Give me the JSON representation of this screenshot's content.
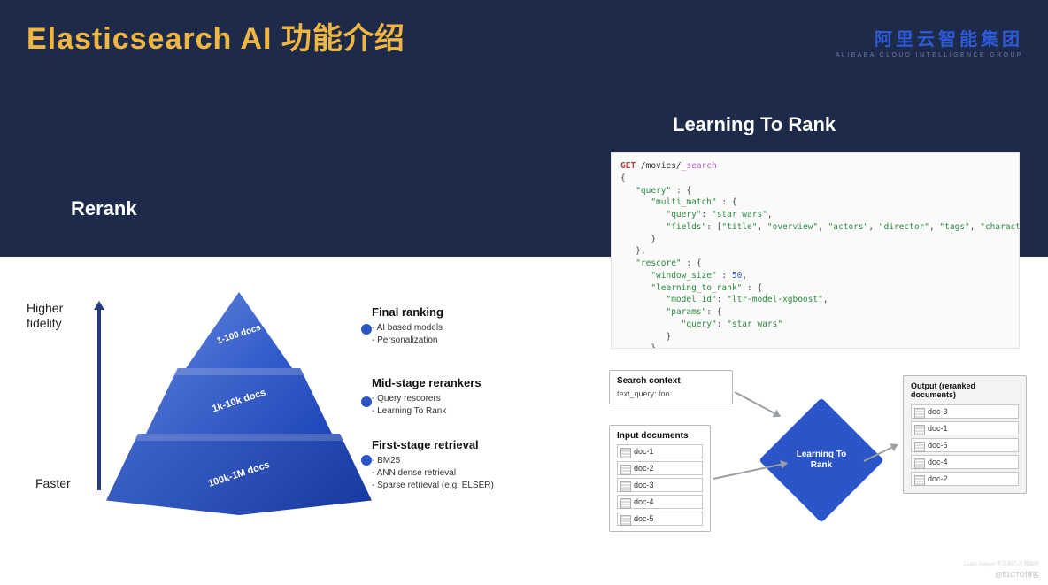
{
  "title": "Elasticsearch AI  功能介绍",
  "brand": {
    "cn": "阿里云智能集团",
    "en": "ALIBABA CLOUD INTELLIGENCE GROUP"
  },
  "left_heading": "Rerank",
  "right_heading": "Learning To Rank",
  "axis": {
    "top1": "Higher",
    "top2": "fidelity",
    "bottom": "Faster"
  },
  "pyramid": {
    "tier1": "1-100 docs",
    "tier2": "1k-10k docs",
    "tier3": "100k-1M docs"
  },
  "stages": [
    {
      "title": "Final ranking",
      "items": [
        "AI based models",
        "Personalization"
      ]
    },
    {
      "title": "Mid-stage rerankers",
      "items": [
        "Query rescorers",
        "Learning To Rank"
      ]
    },
    {
      "title": "First-stage retrieval",
      "items": [
        "BM25",
        "ANN dense retrieval",
        "Sparse retrieval (e.g. ELSER)"
      ]
    }
  ],
  "code": {
    "method": "GET",
    "path_pre": " /movies/",
    "path_us": "_search",
    "body": {
      "query": {
        "multi_match": {
          "query": "star wars",
          "fields": [
            "title",
            "overview",
            "actors",
            "director",
            "tags",
            "characters"
          ]
        }
      },
      "rescore": {
        "window_size": 50,
        "learning_to_rank": {
          "model_id": "ltr-model-xgboost",
          "params": {
            "query": "star wars"
          }
        }
      }
    }
  },
  "flow": {
    "search_ctx_title": "Search context",
    "search_ctx_value": "text_query: foo",
    "input_title": "Input documents",
    "input_docs": [
      "doc-1",
      "doc-2",
      "doc-3",
      "doc-4",
      "doc-5"
    ],
    "node_line1": "Learning To",
    "node_line2": "Rank",
    "output_title": "Output (reranked documents)",
    "output_docs": [
      "doc-3",
      "doc-1",
      "doc-5",
      "doc-4",
      "doc-2"
    ]
  },
  "watermark": "@51CTO博客",
  "watermark2": "Learn Always 不忘初心方得始终"
}
